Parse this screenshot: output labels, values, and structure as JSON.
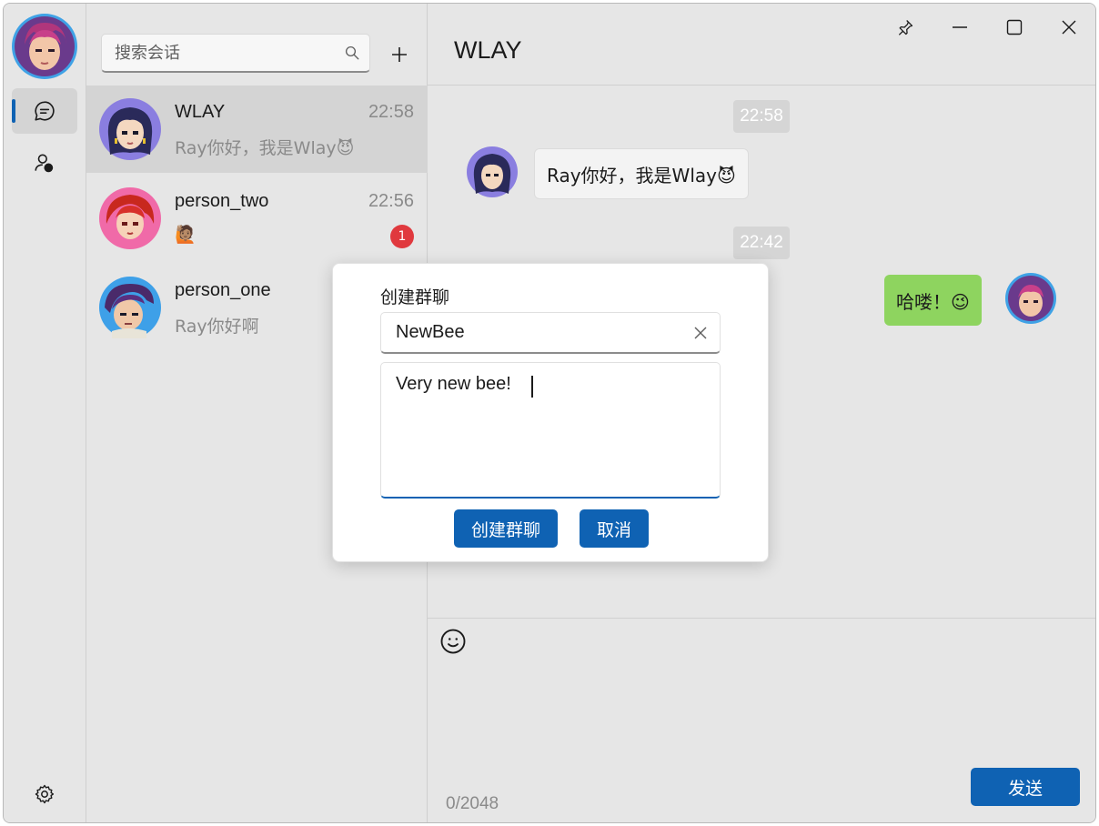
{
  "rail": {
    "chat_icon": "chat-bubble-icon",
    "contacts_icon": "contacts-icon",
    "settings_icon": "gear-icon"
  },
  "list": {
    "search_placeholder": "搜索会话",
    "add_icon": "plus-icon",
    "conversations": [
      {
        "name": "WLAY",
        "time": "22:58",
        "preview": "Ray你好，我是Wlay😈",
        "unread": ""
      },
      {
        "name": "person_two",
        "time": "22:56",
        "preview": "🙋🏽",
        "unread": "1"
      },
      {
        "name": "person_one",
        "time": "",
        "preview": "Ray你好啊",
        "unread": ""
      }
    ]
  },
  "chat": {
    "title": "WLAY",
    "messages": [
      {
        "time": "22:58",
        "text": "Ray你好，我是Wlay😈",
        "direction": "in"
      },
      {
        "time": "22:42",
        "text": "哈喽！😉",
        "direction": "out"
      }
    ],
    "counter": "0/2048",
    "send_label": "发送"
  },
  "dialog": {
    "title": "创建群聊",
    "name_value": "NewBee",
    "description_value": "Very new bee!",
    "create_label": "创建群聊",
    "cancel_label": "取消"
  },
  "colors": {
    "accent": "#0f62b3",
    "outgoing_bubble": "#8ed45f",
    "badge": "#e0393e",
    "background": "#e6e6e6"
  }
}
